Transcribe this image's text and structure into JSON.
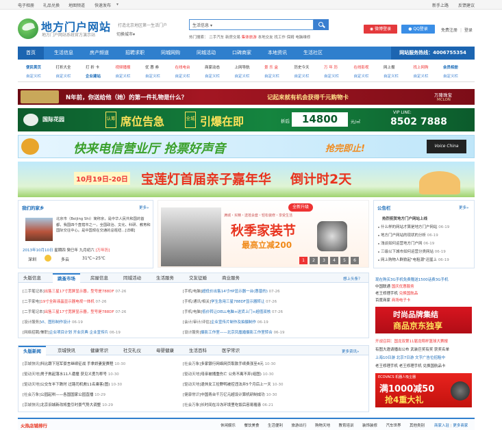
{
  "topbar": {
    "left_links": [
      "电子相册",
      "礼品兑换",
      "地图频道",
      "快速发布"
    ],
    "right_links": [
      "新手上路",
      "反馈建议"
    ]
  },
  "header": {
    "logo_title": "地方门户网站",
    "logo_subtitle": "地方门户网站系统官方演示站",
    "slogan": "打造北京地区第一生活门户",
    "city_switch": "切换城市",
    "search_placeholder": "生活信息",
    "hot_label": "热门搜索：",
    "hot_terms": [
      "二手汽车",
      "新房交易",
      "集体旅游",
      "本地交友",
      "找工作",
      "保姆",
      "电脑维修"
    ],
    "weibo_login": "微博登录",
    "qq_login": "QQ登录",
    "register": "免费注册",
    "login": "登录"
  },
  "nav": {
    "items": [
      "首页",
      "生活信息",
      "房产频道",
      "招聘求职",
      "同城网购",
      "同城活动",
      "口碑商家",
      "本地资讯",
      "生活社区"
    ],
    "hotline": "网站服务热线：4006755354"
  },
  "subnav": {
    "row1": [
      "便民黄页",
      "打折大全",
      "打 折 卡",
      "视频播报",
      "优 惠 券",
      "在线电台",
      "商家动态",
      "上网导航",
      "景 乐 盒",
      "历史今天",
      "万 年 历",
      "在线影视",
      "网上报",
      "找上网购",
      "会员相册"
    ],
    "row2": [
      "自定义栏",
      "自定义栏",
      "企业建站",
      "自定义栏",
      "自定义栏",
      "自定义栏",
      "自定义栏",
      "自定义栏",
      "自定义栏",
      "自定义栏",
      "自定义栏",
      "自定义栏",
      "自定义栏",
      "自定义栏",
      "自定义栏"
    ]
  },
  "banners": {
    "b1_text": "N年前，你送给他（她）的第一件礼物是什么？",
    "b1_text2": "记起来就有机会获得千元购物卡",
    "b1_brand": "万隆珠宝",
    "b1_brand2": "MCLON",
    "b2_brand": "国际花园",
    "b2_tag1": "认筹",
    "b2_text1": "席位告急",
    "b2_tag2": "全城",
    "b2_text2": "引爆在即",
    "b2_discount_label": "折后",
    "b2_number": "14800",
    "b2_unit": "元/㎡",
    "b2_vip_label": "VIP LINE:",
    "b2_phone": "8502 7888",
    "b3_text": "快来电信营业厅 抢票好声音",
    "b3_text2": "抢完即止!",
    "b3_badge": "Voice China",
    "b4_date": "10月19日-20日",
    "b4_text": "宝莲灯首届亲子嘉年华",
    "b4_text2": "倒计时2天"
  },
  "hometown": {
    "title": "我们的家乡",
    "more": "更多»",
    "desc": "北京市（Beijing Shi）简称京，是中华人民共和国的首都，我国四个直辖市之一，全国政治、文化、科研、教育和国际交往中心。是中国现在交通的总枢纽…[详细]",
    "date": "2013年10月10日",
    "weekday": "星期四",
    "lunar": "癸巳年 九月初六",
    "festival": "[万年历]",
    "weather_city": "深圳",
    "weather_desc": "多云",
    "weather_temp": "31℃~25℃"
  },
  "feature": {
    "badge": "全新升级",
    "line1": "满城・买精・送抵会套・轻松装修・享受生活",
    "title": "秋季家装节",
    "subtitle": "最高立减200",
    "pages": [
      "1",
      "2",
      "3",
      "4",
      "5",
      "6"
    ]
  },
  "notice": {
    "title": "公告栏",
    "more": "更多»",
    "headline": "热烈祝贺地方门户网站上线",
    "items": [
      {
        "text": "什么样的网站才算是地方门户网站",
        "date": "06-19"
      },
      {
        "text": "地方门户网站的现状的分析",
        "date": "06-19"
      },
      {
        "text": "浅谈如何运营地方门户网",
        "date": "06-19"
      },
      {
        "text": "三级以下城市如何运营分类网站",
        "date": "06-19"
      },
      {
        "text": "网上购物人群掀起\"电租潮\"迅猛上",
        "date": "06-19"
      }
    ]
  },
  "info_tabs": {
    "tabs": [
      "头版信息",
      "跳蚤市场",
      "房屋信息",
      "同城活动",
      "生活服务",
      "交友征婚",
      "商业服务"
    ],
    "more": "想上头条？",
    "left": [
      {
        "tag": "[二手笔记本]",
        "text": "出售三星17寸宽屏显示器，型号是788DF",
        "date": "07-26"
      },
      {
        "tag": "[二手家电]",
        "text": "19寸全新液晶显示器电视一体机",
        "date": "07-26"
      },
      {
        "tag": "[二手笔记本]",
        "text": "出售三星17寸宽屏显示器，型号是788DF",
        "date": "07-26"
      },
      {
        "tag": "[设计服务]",
        "text": "VI、图形制作设计",
        "date": "06-19"
      },
      {
        "tag": "[网络招聘/兼职]",
        "text": "企业项目计划 开业庆典 企业宣传片",
        "date": "06-19"
      }
    ],
    "right": [
      {
        "tag": "[手机/电脑]",
        "text": "超低价出售14寸HP显示器一台(惠普的)",
        "date": "07-26"
      },
      {
        "tag": "[手机/通讯/相关]",
        "text": "学生急用三星788DF显示器转让",
        "date": "07-26"
      },
      {
        "tag": "[手机/电脑]",
        "text": "低价转让DELL电脑+送货上门+超值双核",
        "date": "07-26"
      },
      {
        "tag": "[会计/审计/评估]",
        "text": "企业宣传片制作及拍摄制作",
        "date": "06-19"
      },
      {
        "tag": "[设计服务]",
        "text": "摄影工作室——北京凤凰婚摄影工作室转合",
        "date": "06-19"
      }
    ]
  },
  "news_tabs": {
    "tabs": [
      "头版新闻",
      "京城快讯",
      "健康常识",
      "社交礼仪",
      "母婴健康",
      "生活百科",
      "医学常识"
    ],
    "more": "更多资讯»",
    "left": [
      {
        "tag": "[京城快讯]",
        "text": "科比跟下冠军豪言继续征战 手拿娇妻复赛程",
        "date": "10-30"
      },
      {
        "tag": "[驱动天地]",
        "text": "男子救起落水11人遭撞 获见义勇为称号",
        "date": "10-30"
      },
      {
        "tag": "[驱动天地]",
        "text": "公交车半下跌时 过路司机救11名乘客(图)",
        "date": "10-30"
      },
      {
        "tag": "[社会万象]",
        "text": "公园起哄——各国国家公园直播",
        "date": "10-29"
      },
      {
        "tag": "[京城快讯]",
        "text": "北京旧城新改将重引时景气势大调整",
        "date": "10-29"
      }
    ],
    "right": [
      {
        "tag": "[社会万象]",
        "text": "多家银行网络网页取款手续费涨至4元",
        "date": "10-30"
      },
      {
        "tag": "[驱动天地]",
        "text": "母亲被捅重伤亡 公务不离不弃(组图)",
        "date": "10-30"
      },
      {
        "tag": "[驱动天地]",
        "text": "退休女工捡野鸭被控违法并5个月后上一天",
        "date": "10-30"
      },
      {
        "tag": "[健康常识]",
        "text": "中国青台千万亿元超设计算机研制成功",
        "date": "10-30"
      },
      {
        "tag": "[社会万象]",
        "text": "长时间在冷冻环境里吃饭后容易罹患",
        "date": "06-21"
      }
    ]
  },
  "right_ads": {
    "list1": [
      {
        "prefix": "现在购买3G手机免费赠送1500话费3G手机",
        "highlight": ""
      },
      {
        "prefix": "中国联通",
        "highlight": "国庆优惠服务"
      },
      {
        "prefix": "老王修理手机",
        "highlight": "兑换国航品"
      },
      {
        "prefix": "百度商家",
        "highlight": "商场电子卡"
      }
    ],
    "jd_line1": "时尚品牌集结",
    "jd_line2": "商品京东独享",
    "list2": [
      {
        "text": "开战召回：国龙双第11届龙翔杯篮球大赛报",
        "color": "red"
      },
      {
        "text": "有图大邀请播出公布 武装巨奖有奖 获奖名单",
        "color": "dark"
      },
      {
        "text": "上海10日游 北京7日游 文字广告位招租中",
        "color": "blue"
      },
      {
        "text": "老王修理手机 老王修理手机 兑换国航品卡",
        "color": "dark"
      }
    ],
    "eco_brand": "ECOVACS 机器人吸尘器",
    "eco_line1": "满1000减50",
    "eco_line2": "抢4重大礼"
  },
  "bottom": {
    "title": "火热店铺排行",
    "cats": [
      "休闲娱乐",
      "餐饮美食",
      "生活便利",
      "旅游出行",
      "购物天地",
      "教育培训",
      "装饰装修",
      "汽车世界",
      "其他类别"
    ],
    "join": "商家入驻",
    "more": "更多商家"
  },
  "colors": {
    "brand_blue": "#2f7fcd",
    "nav_dark": "#1c65b1",
    "accent_red": "#e33"
  }
}
